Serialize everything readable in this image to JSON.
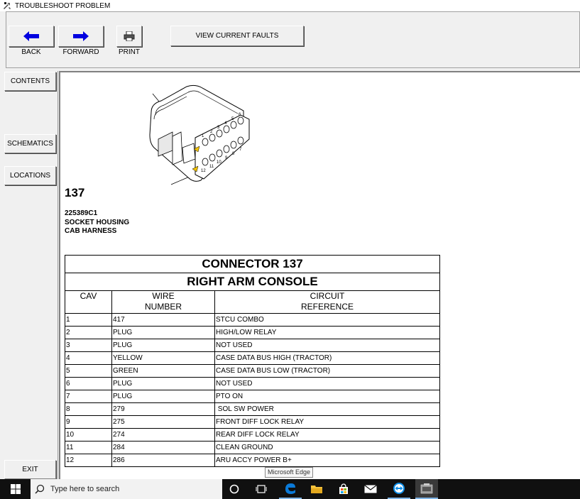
{
  "window": {
    "title": "TROUBLESHOOT PROBLEM"
  },
  "toolbar": {
    "back_label": "BACK",
    "forward_label": "FORWARD",
    "print_label": "PRINT",
    "view_faults_label": "VIEW CURRENT FAULTS"
  },
  "sidebar": {
    "contents": "CONTENTS",
    "schematics": "SCHEMATICS",
    "locations": "LOCATIONS",
    "exit": "EXIT"
  },
  "connector_image": {
    "top_pins": [
      "1",
      "2",
      "3",
      "4",
      "5",
      "6"
    ],
    "bottom_pins": [
      "12",
      "11",
      "10",
      "9",
      "8",
      "7"
    ]
  },
  "part": {
    "number": "137",
    "part_no": "225389C1",
    "type": "SOCKET HOUSING",
    "harness": "CAB HARNESS"
  },
  "table": {
    "title": "CONNECTOR 137",
    "subtitle": "RIGHT ARM CONSOLE",
    "headers": {
      "cav": "CAV",
      "wire_1": "WIRE",
      "wire_2": "NUMBER",
      "circuit_1": "CIRCUIT",
      "circuit_2": "REFERENCE"
    },
    "rows": [
      {
        "cav": "1",
        "wire": "417",
        "circuit": "STCU COMBO"
      },
      {
        "cav": "2",
        "wire": "PLUG",
        "circuit": "HIGH/LOW RELAY"
      },
      {
        "cav": "3",
        "wire": "PLUG",
        "circuit": "NOT USED"
      },
      {
        "cav": "4",
        "wire": "YELLOW",
        "circuit": "CASE DATA BUS HIGH (TRACTOR)"
      },
      {
        "cav": "5",
        "wire": "GREEN",
        "circuit": "CASE DATA BUS LOW (TRACTOR)"
      },
      {
        "cav": "6",
        "wire": "PLUG",
        "circuit": "NOT USED"
      },
      {
        "cav": "7",
        "wire": "PLUG",
        "circuit": "PTO ON"
      },
      {
        "cav": "8",
        "wire": "279",
        "circuit": " SOL SW POWER"
      },
      {
        "cav": "9",
        "wire": "275",
        "circuit": "FRONT DIFF LOCK RELAY"
      },
      {
        "cav": "10",
        "wire": "274",
        "circuit": "REAR DIFF LOCK RELAY"
      },
      {
        "cav": "11",
        "wire": "284",
        "circuit": "CLEAN GROUND"
      },
      {
        "cav": "12",
        "wire": "286",
        "circuit": "ARU ACCY POWER B+"
      }
    ]
  },
  "tooltip": {
    "text": "Microsoft Edge"
  },
  "taskbar": {
    "search_placeholder": "Type here to search",
    "icons": [
      "windows-start-icon",
      "search-icon",
      "cortana-icon",
      "task-view-icon",
      "edge-icon",
      "file-explorer-icon",
      "store-icon",
      "mail-icon",
      "teamviewer-icon",
      "est-app-icon"
    ]
  },
  "colors": {
    "arrow_blue": "#0000e0",
    "taskbar": "#101010",
    "edge_blue": "#0a7ad9",
    "folder_yellow": "#f4c23c"
  }
}
